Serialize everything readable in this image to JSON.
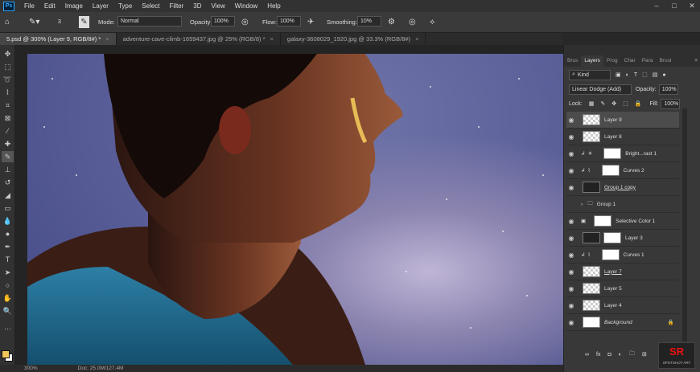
{
  "app": {
    "logo": "Ps"
  },
  "menu": [
    "File",
    "Edit",
    "Image",
    "Layer",
    "Type",
    "Select",
    "Filter",
    "3D",
    "View",
    "Window",
    "Help"
  ],
  "options": {
    "brush_size": "3",
    "mode_label": "Mode:",
    "mode_value": "Normal",
    "opacity_label": "Opacity:",
    "opacity_value": "100%",
    "flow_label": "Flow:",
    "flow_value": "100%",
    "smoothing_label": "Smoothing:",
    "smoothing_value": "10%"
  },
  "tabs": [
    {
      "label": "5.psd @ 300% (Layer 9, RGB/8#) *",
      "active": true
    },
    {
      "label": "adventure-cave-climb-1659437.jpg @ 25% (RGB/8) *",
      "active": false
    },
    {
      "label": "galaxy-3608029_1920.jpg @ 33.3% (RGB/8#)",
      "active": false
    }
  ],
  "status": {
    "zoom": "300%",
    "doc": "Doc: 25.0M/127.4M"
  },
  "panel": {
    "tabs": [
      "Brus",
      "Layers",
      "Prog",
      "Char",
      "Para",
      "Brusl"
    ],
    "active_tab": "Layers",
    "filter_kind": "Kind",
    "blend_mode": "Linear Dodge (Add)",
    "opacity_label": "Opacity:",
    "opacity_value": "100%",
    "lock_label": "Lock:",
    "fill_label": "Fill:",
    "fill_value": "100%",
    "layers": [
      {
        "name": "Layer 9",
        "active": true
      },
      {
        "name": "Layer 8"
      },
      {
        "name": "Bright...rast 1"
      },
      {
        "name": "Curves 2"
      },
      {
        "name": "Group 1 copy"
      },
      {
        "name": "Group 1"
      },
      {
        "name": "Selective Color 1"
      },
      {
        "name": "Layer 3"
      },
      {
        "name": "Curves 1"
      },
      {
        "name": "Layer 7"
      },
      {
        "name": "Layer 5"
      },
      {
        "name": "Layer 4"
      },
      {
        "name": "Background"
      }
    ]
  },
  "watermark": {
    "logo": "SR",
    "text": "SPOTSHOT ART"
  },
  "colors": {
    "foreground": "#f4c55b",
    "background": "#ffffff"
  }
}
